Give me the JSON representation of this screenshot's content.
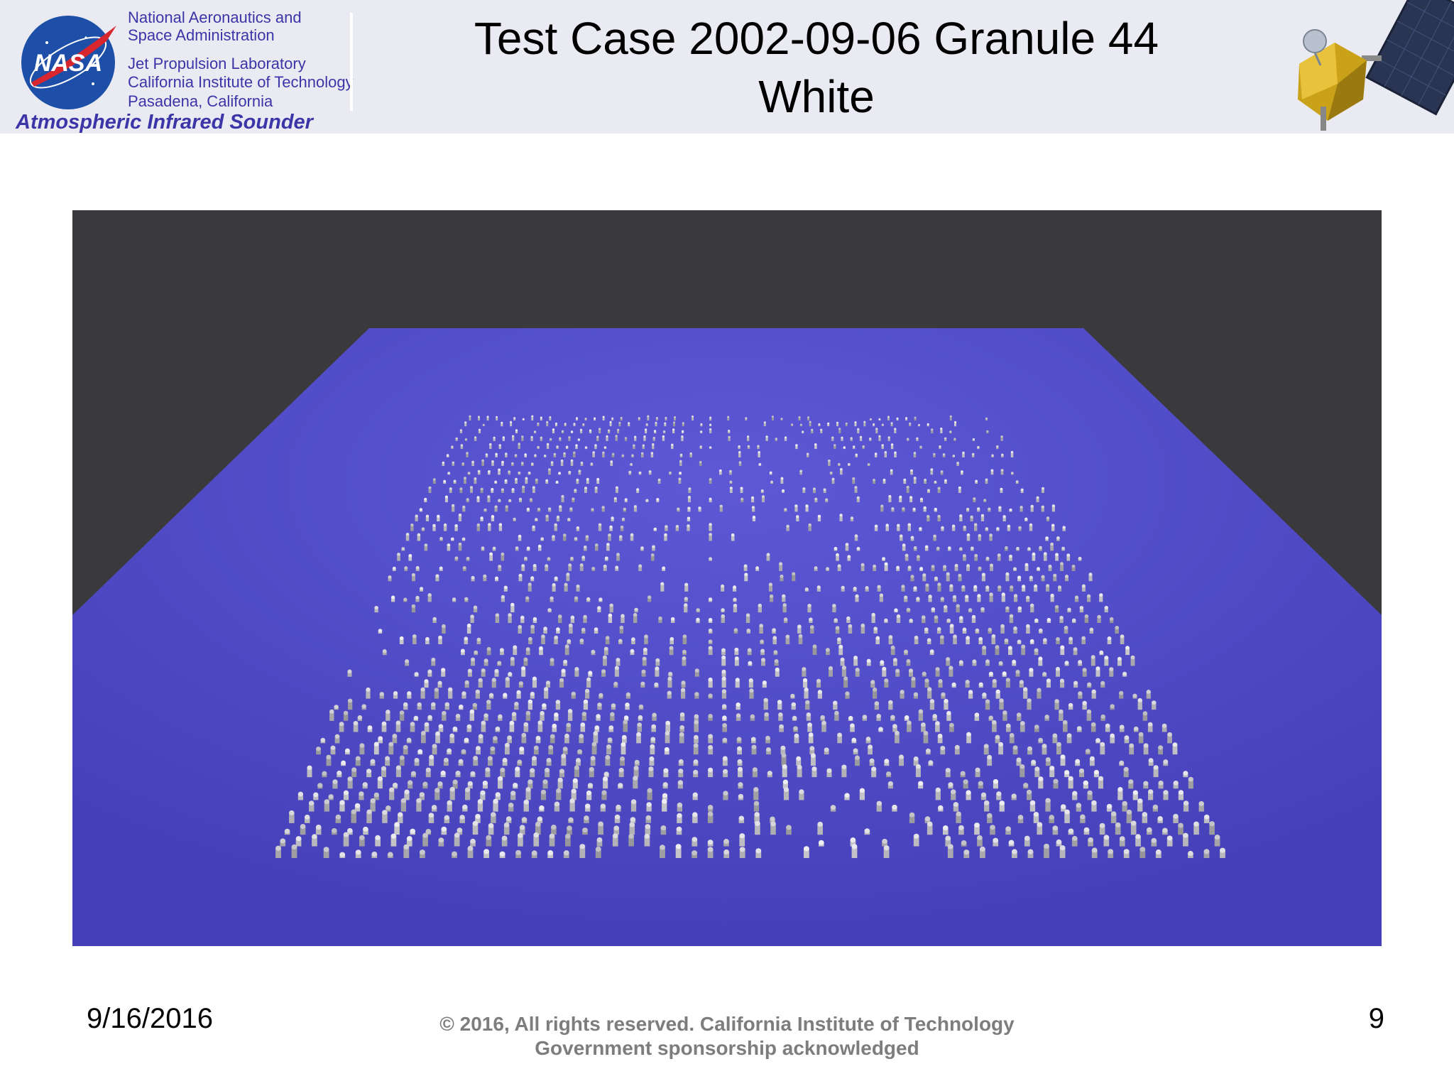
{
  "header": {
    "logo_label": "NASA",
    "org_lines": [
      "National Aeronautics and",
      "Space Administration",
      "Jet Propulsion Laboratory",
      "California Institute of Technology",
      "Pasadena, California"
    ],
    "instrument": "Atmospheric Infrared Sounder",
    "title_line1": "Test Case 2002-09-06 Granule 44",
    "title_line2": "White"
  },
  "figure": {
    "description_icon": "3d-cloud-voxel-render"
  },
  "footer": {
    "date": "9/16/2016",
    "copyright_line1": "© 2016, All rights reserved. California Institute of Technology",
    "copyright_line2": "Government sponsorship acknowledged",
    "page_number": "9"
  },
  "colors": {
    "accent": "#3b35a8",
    "header_bg": "#eaeaf2",
    "scene_floor": "#4a45c4",
    "scene_backdrop": "#3a3a3c"
  }
}
